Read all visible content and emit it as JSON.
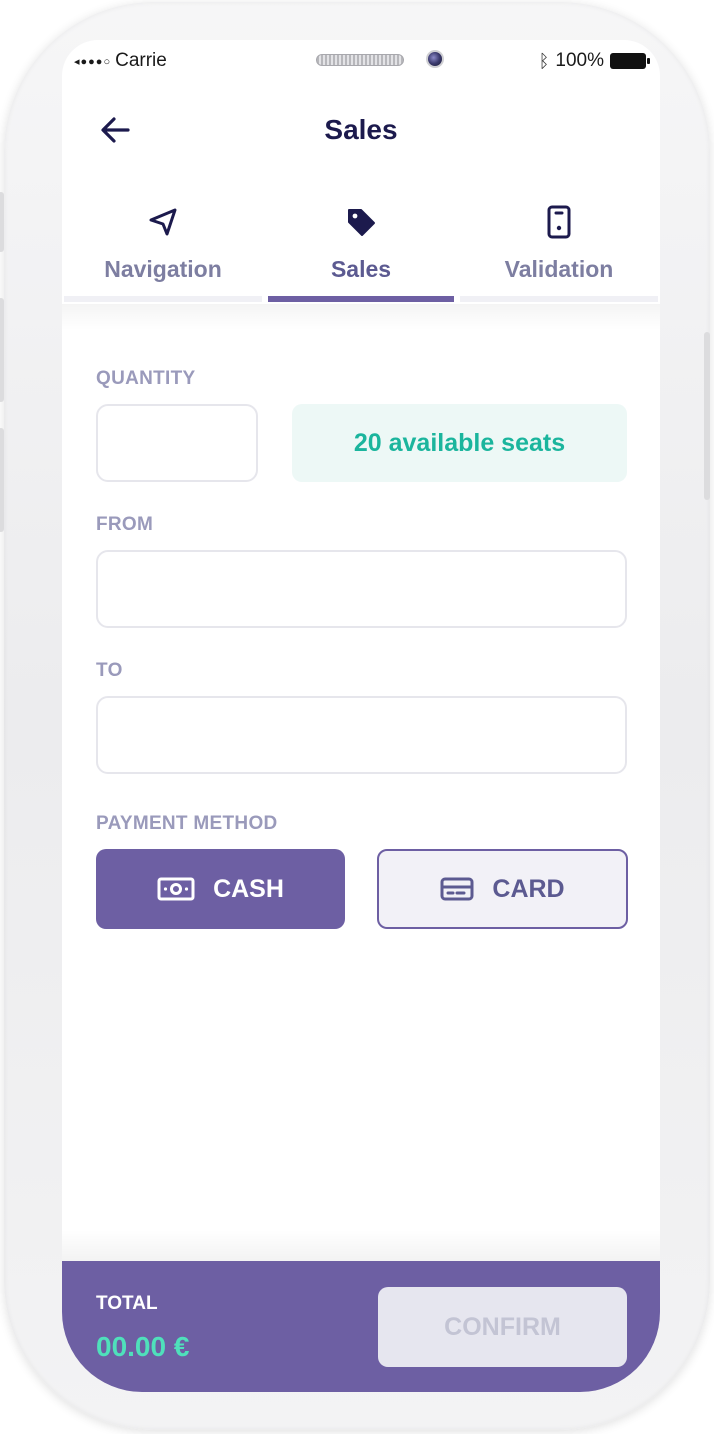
{
  "status_bar": {
    "carrier": "Carrie",
    "signal_dots": "◂●●●○",
    "battery_text": "100%",
    "bluetooth_symbol": "ᛒ"
  },
  "header": {
    "title": "Sales",
    "back_icon": "arrow-left-icon"
  },
  "tabs": [
    {
      "label": "Navigation",
      "icon": "navigation-arrow-icon",
      "active": false
    },
    {
      "label": "Sales",
      "icon": "price-tag-icon",
      "active": true
    },
    {
      "label": "Validation",
      "icon": "mobile-phone-icon",
      "active": false
    }
  ],
  "form": {
    "quantity_label": "QUANTITY",
    "quantity_value": "",
    "seats_text": "20 available seats",
    "from_label": "FROM",
    "from_value": "",
    "to_label": "TO",
    "to_value": "",
    "payment_label": "PAYMENT METHOD",
    "payment_options": [
      {
        "label": "CASH",
        "icon": "cash-icon",
        "selected": true
      },
      {
        "label": "CARD",
        "icon": "credit-card-icon",
        "selected": false
      }
    ]
  },
  "footer": {
    "total_label": "TOTAL",
    "total_value": "00.00 €",
    "confirm_label": "CONFIRM",
    "confirm_enabled": false
  },
  "colors": {
    "primary": "#6d5fa3",
    "title": "#1c1a4d",
    "accent_green": "#1bb59d",
    "total_green": "#4fe0bb",
    "label_gray": "#9a9abb"
  }
}
